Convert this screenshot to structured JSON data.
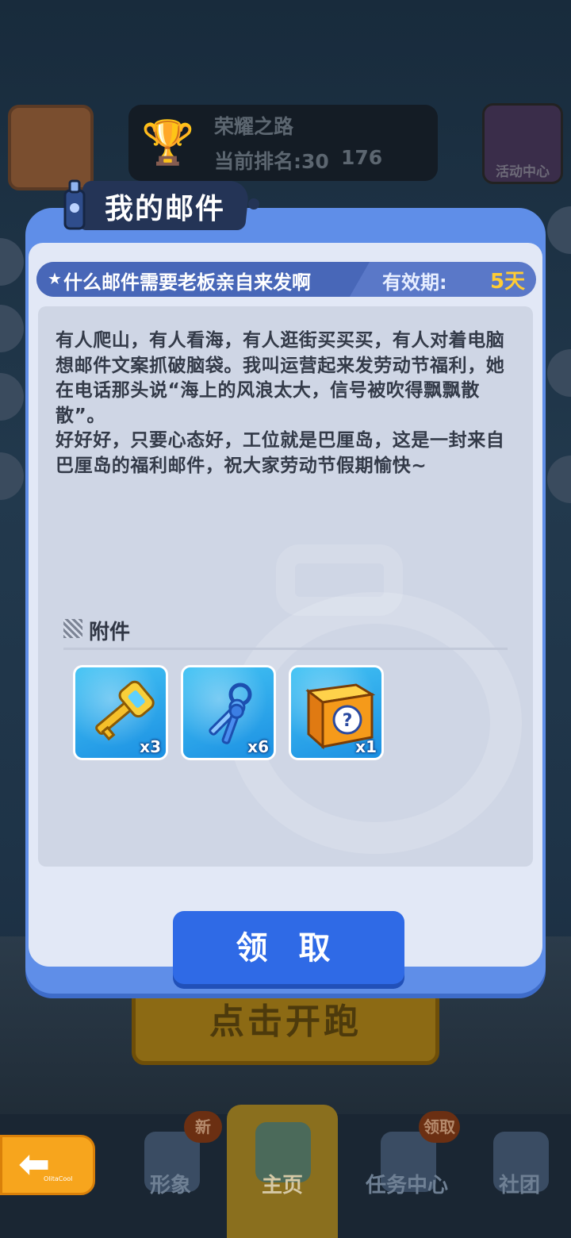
{
  "background": {
    "rank_panel": {
      "title": "荣耀之路",
      "rank": "当前排名:30",
      "trophies": "176"
    },
    "event_center": "活动中心",
    "start_button": "点击开跑",
    "nav": [
      {
        "label": "形象",
        "badge": "新"
      },
      {
        "label": "主页",
        "badge": ""
      },
      {
        "label": "任务中心",
        "badge": "领取"
      },
      {
        "label": "社团",
        "badge": ""
      }
    ],
    "back_tag": "OlitaCool"
  },
  "dialog": {
    "title": "我的邮件",
    "subject": "什么邮件需要老板亲自来发啊",
    "validity_label": "有效期:",
    "validity_value": "5天",
    "body": "有人爬山，有人看海，有人逛街买买买，有人对着电脑想邮件文案抓破脑袋。我叫运营起来发劳动节福利，她在电话那头说“海上的风浪太大，信号被吹得飘飘散散”。\n好好好，只要心态好，工位就是巴厘岛，这是一封来自巴厘岛的福利邮件，祝大家劳动节假期愉快~",
    "attachments_label": "附件",
    "attachments": [
      {
        "icon": "gold-key-icon",
        "count": "x3"
      },
      {
        "icon": "blue-keys-icon",
        "count": "x6"
      },
      {
        "icon": "mystery-box-icon",
        "count": "x1"
      }
    ],
    "claim_button": "领 取"
  },
  "colors": {
    "dialog_frame": "#5f8ee8",
    "claim_button": "#2f6ae6",
    "validity_value": "#ffcc33",
    "item_tile": "#2fa8ee"
  }
}
